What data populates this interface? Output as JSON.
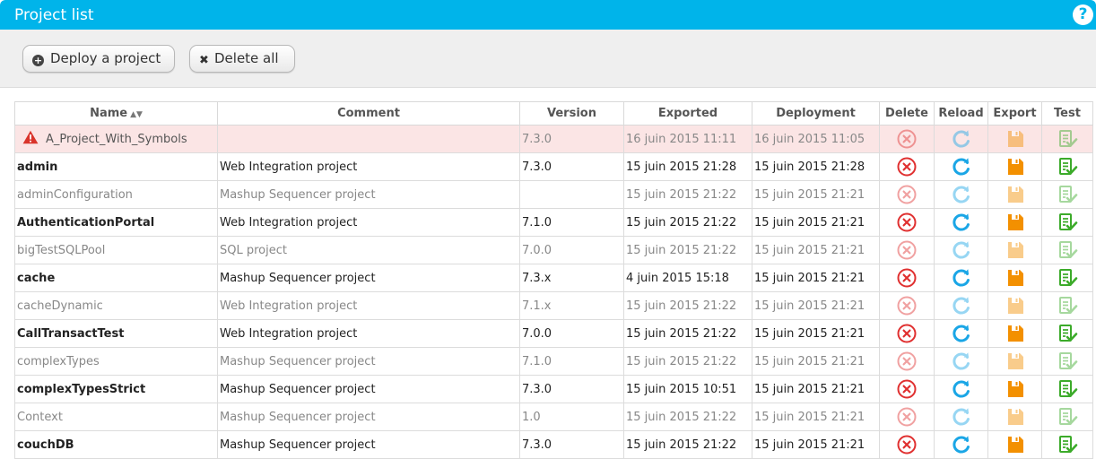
{
  "window": {
    "title": "Project list",
    "help_label": "?"
  },
  "toolbar": {
    "deploy_label": "Deploy a project",
    "delete_all_label": "Delete all"
  },
  "table": {
    "columns": [
      "Name",
      "Comment",
      "Version",
      "Exported",
      "Deployment",
      "Delete",
      "Reload",
      "Export",
      "Test"
    ],
    "rows": [
      {
        "name": "A_Project_With_Symbols",
        "comment": "",
        "version": "7.3.0",
        "exported": "16 juin 2015 11:11",
        "deployment": "16 juin 2015 11:05",
        "state": "error"
      },
      {
        "name": "admin",
        "comment": "Web Integration project",
        "version": "7.3.0",
        "exported": "15 juin 2015 21:28",
        "deployment": "15 juin 2015 21:28",
        "state": "active"
      },
      {
        "name": "adminConfiguration",
        "comment": "Mashup Sequencer project",
        "version": "",
        "exported": "15 juin 2015 21:22",
        "deployment": "15 juin 2015 21:21",
        "state": "inactive"
      },
      {
        "name": "AuthenticationPortal",
        "comment": "Web Integration project",
        "version": "7.1.0",
        "exported": "15 juin 2015 21:22",
        "deployment": "15 juin 2015 21:21",
        "state": "active"
      },
      {
        "name": "bigTestSQLPool",
        "comment": "SQL project",
        "version": "7.0.0",
        "exported": "15 juin 2015 21:22",
        "deployment": "15 juin 2015 21:21",
        "state": "inactive"
      },
      {
        "name": "cache",
        "comment": "Mashup Sequencer project",
        "version": "7.3.x",
        "exported": "4 juin 2015 15:18",
        "deployment": "15 juin 2015 21:21",
        "state": "active"
      },
      {
        "name": "cacheDynamic",
        "comment": "Web Integration project",
        "version": "7.1.x",
        "exported": "15 juin 2015 21:22",
        "deployment": "15 juin 2015 21:21",
        "state": "inactive"
      },
      {
        "name": "CallTransactTest",
        "comment": "Web Integration project",
        "version": "7.0.0",
        "exported": "15 juin 2015 21:22",
        "deployment": "15 juin 2015 21:21",
        "state": "active"
      },
      {
        "name": "complexTypes",
        "comment": "Mashup Sequencer project",
        "version": "7.1.0",
        "exported": "15 juin 2015 21:22",
        "deployment": "15 juin 2015 21:21",
        "state": "inactive"
      },
      {
        "name": "complexTypesStrict",
        "comment": "Mashup Sequencer project",
        "version": "7.3.0",
        "exported": "15 juin 2015 10:51",
        "deployment": "15 juin 2015 21:21",
        "state": "active"
      },
      {
        "name": "Context",
        "comment": "Mashup Sequencer project",
        "version": "1.0",
        "exported": "15 juin 2015 21:22",
        "deployment": "15 juin 2015 21:21",
        "state": "inactive"
      },
      {
        "name": "couchDB",
        "comment": "Mashup Sequencer project",
        "version": "7.3.0",
        "exported": "15 juin 2015 21:22",
        "deployment": "15 juin 2015 21:21",
        "state": "active"
      }
    ]
  },
  "icons": {
    "help": "help-icon",
    "deploy": "plus-circle-icon",
    "delete_all": "close-icon",
    "warning": "warning-icon",
    "delete": "delete-circle-icon",
    "reload": "reload-icon",
    "export": "save-icon",
    "test": "test-checklist-icon"
  },
  "colors": {
    "accent": "#00b4ea",
    "delete": "#e03030",
    "reload": "#1aa6e6",
    "export": "#f39000",
    "test": "#3cab2a",
    "warning": "#d9342b",
    "error_row": "#fbe5e5"
  }
}
